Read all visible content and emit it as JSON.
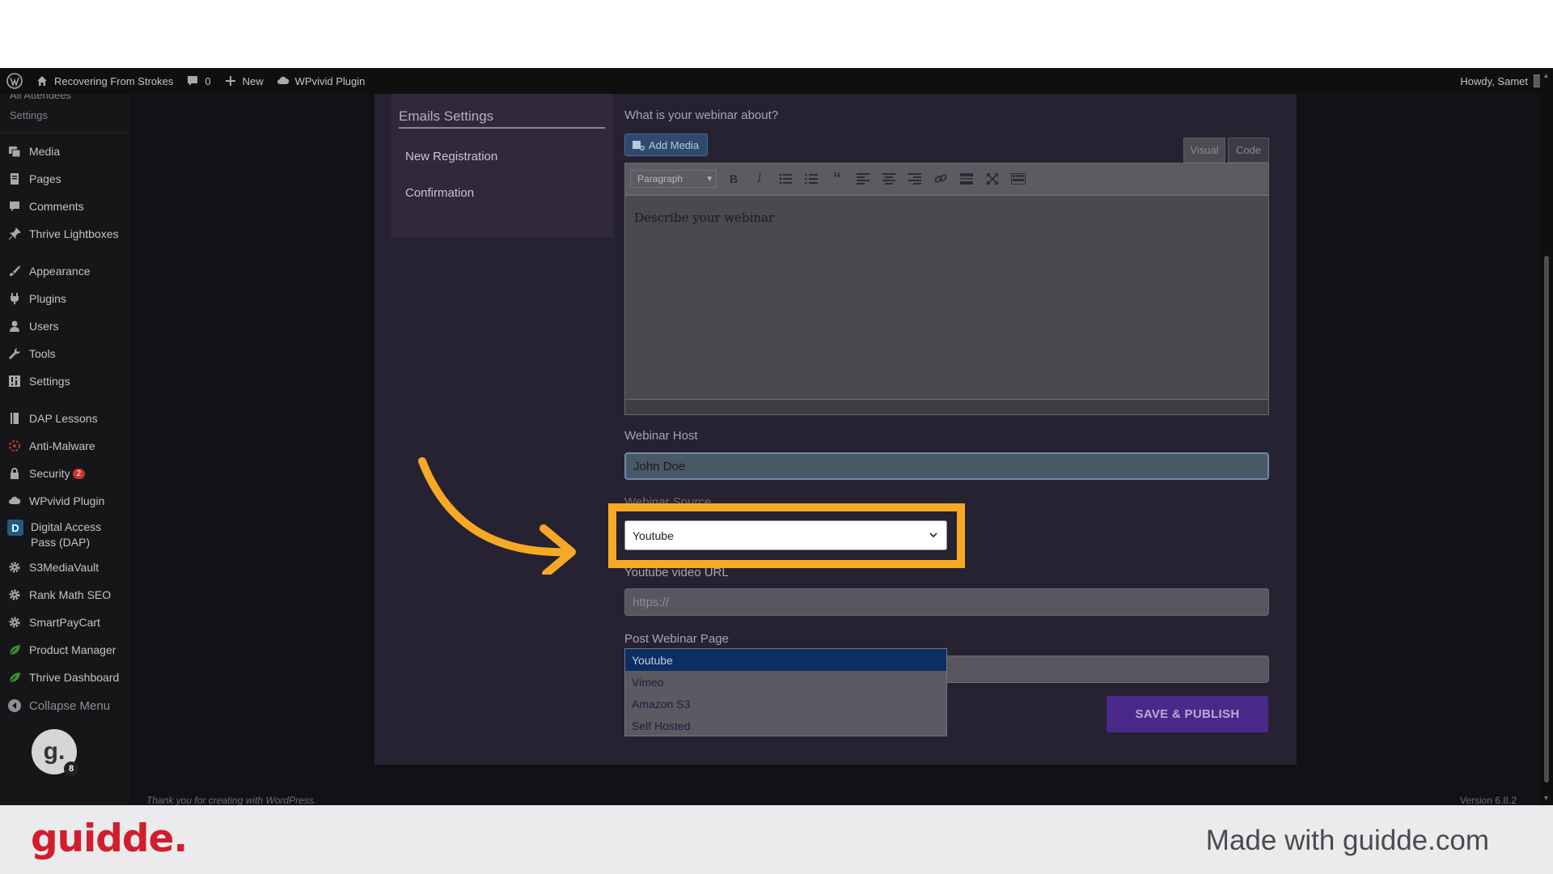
{
  "admin_bar": {
    "site_name": "Recovering From Strokes",
    "comments_count": "0",
    "new_label": "New",
    "plugin_label": "WPvivid Plugin",
    "greeting": "Howdy, Samet"
  },
  "sidebar": {
    "faded_top": "All Attendees",
    "faded_settings": "Settings",
    "items": [
      {
        "label": "Media",
        "icon": "media-icon"
      },
      {
        "label": "Pages",
        "icon": "pages-icon"
      },
      {
        "label": "Comments",
        "icon": "comments-icon"
      },
      {
        "label": "Thrive Lightboxes",
        "icon": "pin-icon"
      },
      {
        "label": "Appearance",
        "icon": "brush-icon"
      },
      {
        "label": "Plugins",
        "icon": "plug-icon"
      },
      {
        "label": "Users",
        "icon": "user-icon"
      },
      {
        "label": "Tools",
        "icon": "wrench-icon"
      },
      {
        "label": "Settings",
        "icon": "settings-icon"
      },
      {
        "label": "DAP Lessons",
        "icon": "book-icon"
      },
      {
        "label": "Anti-Malware",
        "icon": "shield-icon"
      },
      {
        "label": "Security",
        "icon": "lock-icon",
        "badge": "2"
      },
      {
        "label": "WPvivid Plugin",
        "icon": "cloud-icon"
      },
      {
        "label": "Digital Access Pass (DAP)",
        "icon": "dap-icon",
        "icon_text": "D"
      },
      {
        "label": "S3MediaVault",
        "icon": "gear-icon"
      },
      {
        "label": "Rank Math SEO",
        "icon": "gear-icon"
      },
      {
        "label": "SmartPayCart",
        "icon": "gear-icon"
      },
      {
        "label": "Product Manager",
        "icon": "leaf-icon"
      },
      {
        "label": "Thrive Dashboard",
        "icon": "leaf-icon"
      }
    ],
    "collapse_label": "Collapse Menu",
    "avatar_letter": "g.",
    "avatar_count": "8"
  },
  "settings_card": {
    "title": "Emails Settings",
    "links": [
      "New Registration",
      "Confirmation"
    ]
  },
  "form": {
    "about_label": "What is your webinar about?",
    "add_media_label": "Add Media",
    "tab_visual": "Visual",
    "tab_code": "Code",
    "format_value": "Paragraph",
    "editor_text": "Describe your webinar",
    "host_label": "Webinar Host",
    "host_value": "John Doe",
    "source_label": "Webinar Source",
    "source_value": "Youtube",
    "url_label": "Youtube video URL",
    "url_placeholder": "https://",
    "post_label": "Post Webinar Page",
    "source_options": [
      "Youtube",
      "Vimeo",
      "Amazon S3",
      "Self Hosted"
    ],
    "selected_option": "Youtube",
    "save_label": "SAVE & PUBLISH"
  },
  "footer": {
    "thanks": "Thank you for creating with WordPress.",
    "version": "Version 6.8.2"
  },
  "guidde": {
    "logo": "guidde.",
    "made_with": "Made with guidde.com"
  },
  "colors": {
    "highlight": "#f7a925",
    "save_button": "#4a2a88",
    "selected_option": "#0b2f63",
    "guidde_red": "#cf1f2e"
  }
}
